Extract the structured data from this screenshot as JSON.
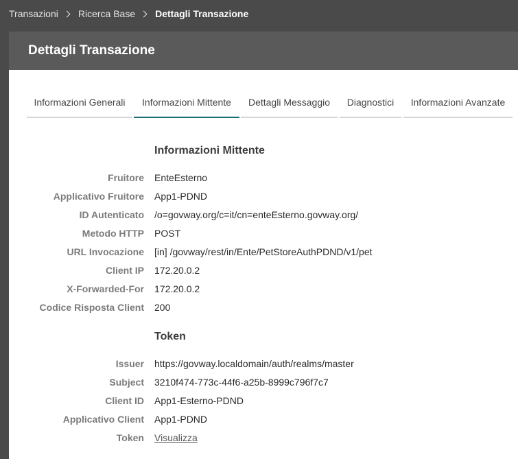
{
  "breadcrumb": {
    "items": [
      "Transazioni",
      "Ricerca Base",
      "Dettagli Transazione"
    ]
  },
  "panel": {
    "title": "Dettagli Transazione"
  },
  "tabs": [
    {
      "label": "Informazioni Generali",
      "active": false
    },
    {
      "label": "Informazioni Mittente",
      "active": true
    },
    {
      "label": "Dettagli Messaggio",
      "active": false
    },
    {
      "label": "Diagnostici",
      "active": false
    },
    {
      "label": "Informazioni Avanzate",
      "active": false
    }
  ],
  "mittente": {
    "title": "Informazioni Mittente",
    "rows": [
      {
        "label": "Fruitore",
        "value": "EnteEsterno"
      },
      {
        "label": "Applicativo Fruitore",
        "value": "App1-PDND"
      },
      {
        "label": "ID Autenticato",
        "value": "/o=govway.org/c=it/cn=enteEsterno.govway.org/"
      },
      {
        "label": "Metodo HTTP",
        "value": "POST"
      },
      {
        "label": "URL Invocazione",
        "value": "[in] /govway/rest/in/Ente/PetStoreAuthPDND/v1/pet"
      },
      {
        "label": "Client IP",
        "value": "172.20.0.2"
      },
      {
        "label": "X-Forwarded-For",
        "value": "172.20.0.2"
      },
      {
        "label": "Codice Risposta Client",
        "value": "200"
      }
    ]
  },
  "token": {
    "title": "Token",
    "rows": [
      {
        "label": "Issuer",
        "value": "https://govway.localdomain/auth/realms/master"
      },
      {
        "label": "Subject",
        "value": "3210f474-773c-44f6-a25b-8999c796f7c7"
      },
      {
        "label": "Client ID",
        "value": "App1-Esterno-PDND"
      },
      {
        "label": "Applicativo Client",
        "value": "App1-PDND"
      },
      {
        "label": "Token",
        "value": "Visualizza"
      }
    ]
  }
}
